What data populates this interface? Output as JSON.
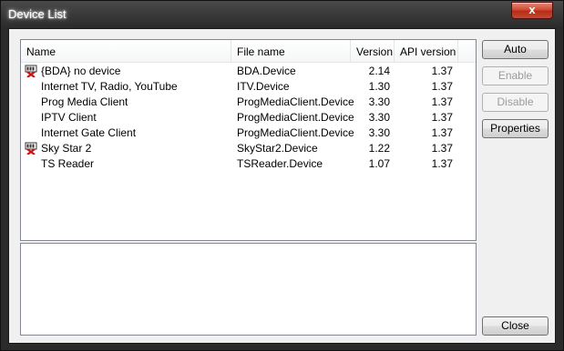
{
  "window": {
    "title": "Device List",
    "close_glyph": "x"
  },
  "table": {
    "columns": [
      "Name",
      "File name",
      "Version",
      "API version"
    ],
    "rows": [
      {
        "name": "{BDA} no device",
        "file": "BDA.Device",
        "version": "2.14",
        "api": "1.37",
        "icon": "device-error-icon"
      },
      {
        "name": "Internet TV, Radio, YouTube",
        "file": "ITV.Device",
        "version": "1.30",
        "api": "1.37",
        "icon": ""
      },
      {
        "name": "Prog Media Client",
        "file": "ProgMediaClient.Device",
        "version": "3.30",
        "api": "1.37",
        "icon": ""
      },
      {
        "name": "IPTV Client",
        "file": "ProgMediaClient.Device",
        "version": "3.30",
        "api": "1.37",
        "icon": ""
      },
      {
        "name": "Internet Gate Client",
        "file": "ProgMediaClient.Device",
        "version": "3.30",
        "api": "1.37",
        "icon": ""
      },
      {
        "name": "Sky Star 2",
        "file": "SkyStar2.Device",
        "version": "1.22",
        "api": "1.37",
        "icon": "device-error-icon"
      },
      {
        "name": "TS Reader",
        "file": "TSReader.Device",
        "version": "1.07",
        "api": "1.37",
        "icon": ""
      }
    ]
  },
  "buttons": {
    "auto": "Auto",
    "enable": "Enable",
    "disable": "Disable",
    "properties": "Properties",
    "close": "Close"
  }
}
